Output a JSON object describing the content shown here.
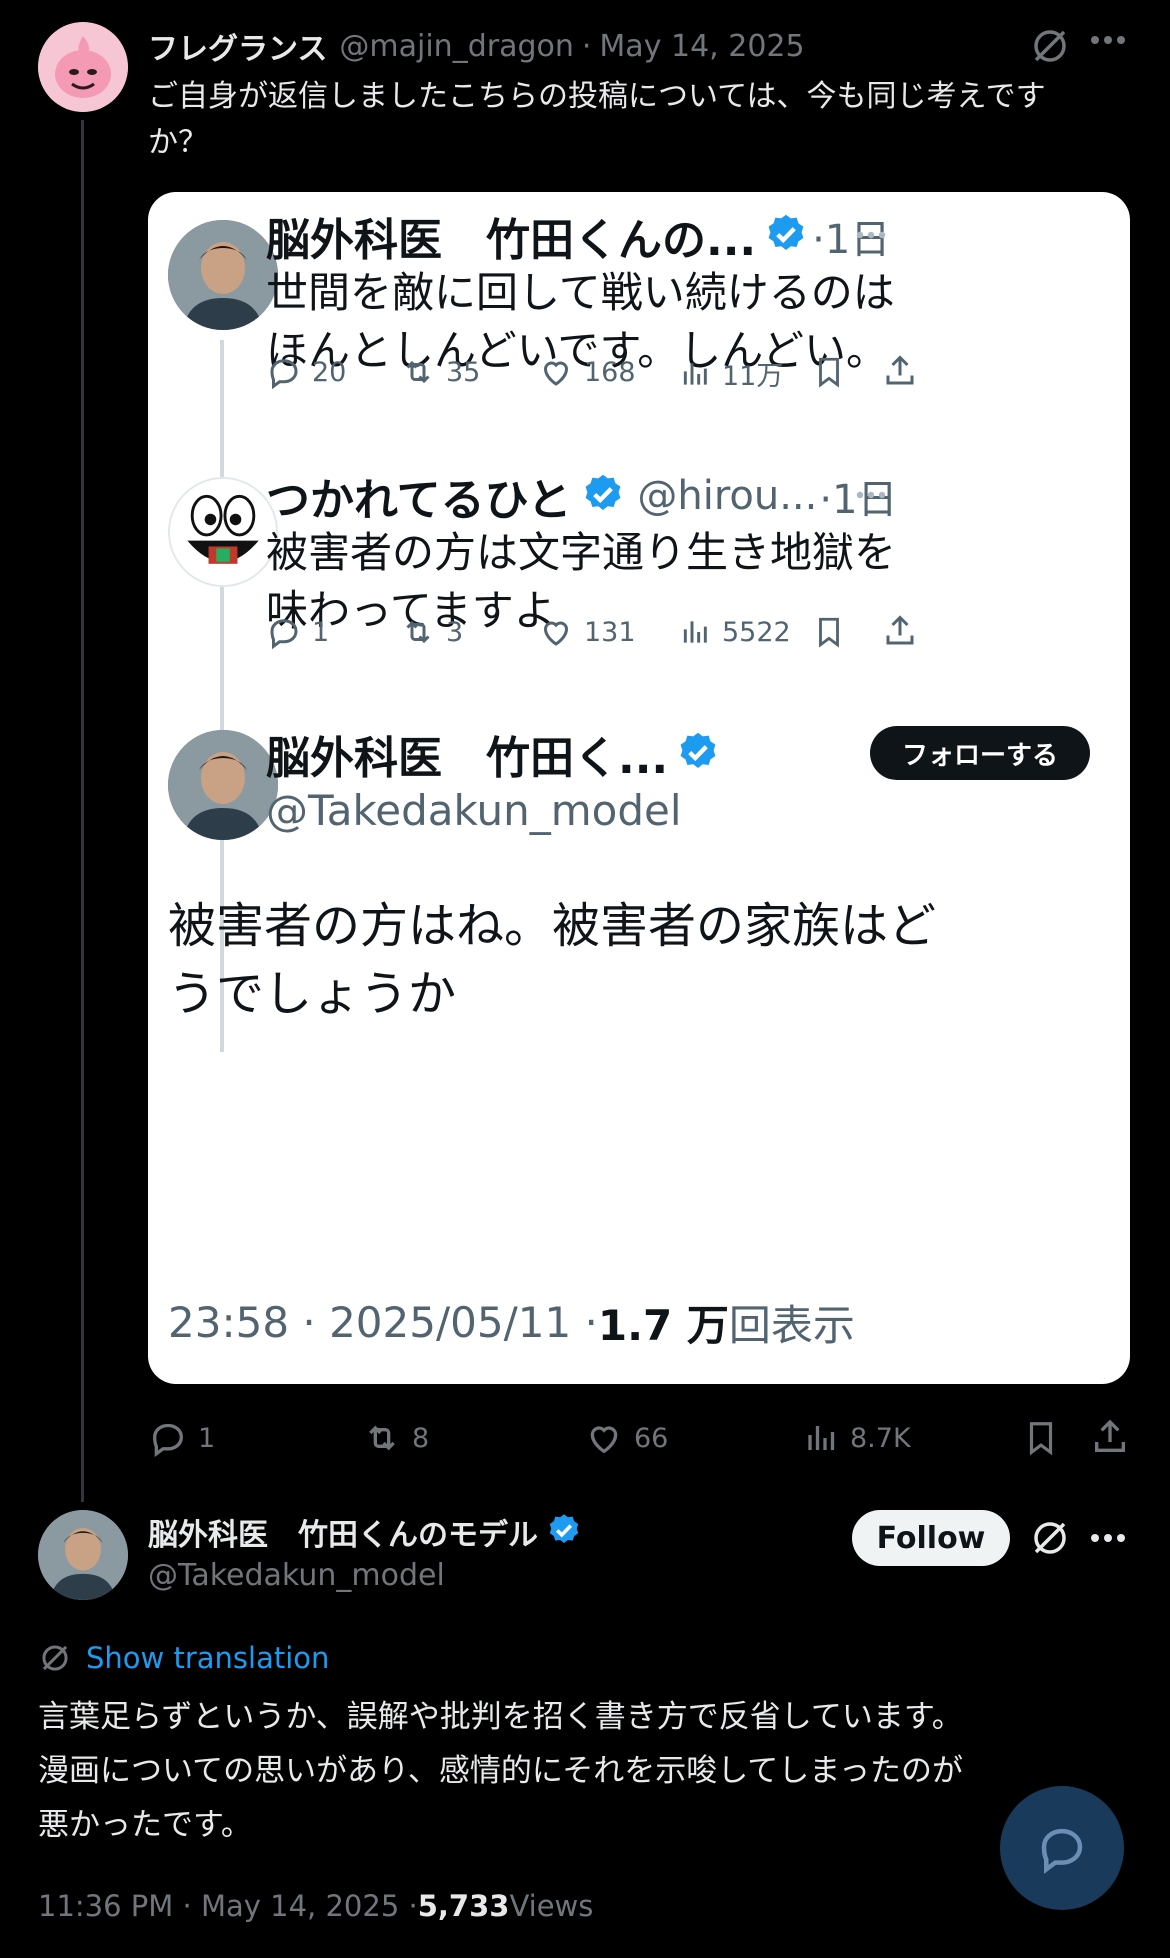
{
  "quote_post": {
    "display_name": "フレグランス",
    "handle": "@majin_dragon",
    "date": "May 14, 2025",
    "text_line1": "ご自身が返信しましたこちらの投稿については、今も同じ考えです",
    "text_line2": "か？",
    "stats": {
      "replies": "1",
      "retweets": "8",
      "likes": "66",
      "views": "8.7K"
    }
  },
  "screenshot_card": {
    "tweet1": {
      "name": "脳外科医　竹田くんの...",
      "time": "·1日",
      "text_line1": "世間を敵に回して戦い続けるのは",
      "text_line2": "ほんとしんどいです。しんどい。",
      "stats": {
        "replies": "20",
        "retweets": "35",
        "likes": "168",
        "views": "11万"
      }
    },
    "tweet2": {
      "name": "つかれてるひと",
      "handle": "@hirou...",
      "time": "·1日",
      "text_line1": "被害者の方は文字通り生き地獄を",
      "text_line2": "味わってますよ",
      "stats": {
        "replies": "1",
        "retweets": "3",
        "likes": "131",
        "views": "5522"
      }
    },
    "tweet3": {
      "name": "脳外科医　竹田く...",
      "handle": "@Takedakun_model",
      "follow_label": "フォローする",
      "text_line1": "被害者の方はね。被害者の家族はど",
      "text_line2": "うでしょうか",
      "time": "23:58 · 2025/05/11 · ",
      "views_num": "1.7 万",
      "views_label": "回表示"
    }
  },
  "reply_post": {
    "display_name": "脳外科医　竹田くんのモデル",
    "handle": "@Takedakun_model",
    "follow_label": "Follow",
    "translate_label": "Show translation",
    "text_line1": "言葉足らずというか、誤解や批判を招く書き方で反省しています。",
    "text_line2": "漫画についての思いがあり、感情的にそれを示唆してしまったのが",
    "text_line3": "悪かったです。",
    "time": "11:36 PM · May 14, 2025 · ",
    "views_num": "5,733",
    "views_label": " Views"
  },
  "colors": {
    "verified": "#1d9bf0",
    "link": "#1d9bf0",
    "fab": "#1a3a5c"
  }
}
